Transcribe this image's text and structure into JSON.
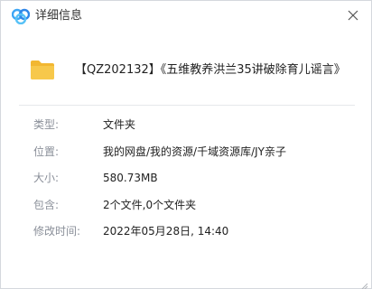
{
  "window": {
    "title": "详细信息",
    "logo_icon": "baidu-netdisk-logo-icon",
    "close_icon": "close-icon"
  },
  "file": {
    "icon": "folder-icon",
    "name": "【QZ202132】《五维教养洪兰35讲破除育儿谣言》",
    "folder_color": "#f7c84b"
  },
  "properties": [
    {
      "label": "类型:",
      "value": "文件夹"
    },
    {
      "label": "位置:",
      "value": "我的网盘/我的资源/千域资源库/JY亲子"
    },
    {
      "label": "大小:",
      "value": "580.73MB"
    },
    {
      "label": "包含:",
      "value": "2个文件,0个文件夹"
    },
    {
      "label": "修改时间:",
      "value": "2022年05月28日, 14:40"
    }
  ]
}
